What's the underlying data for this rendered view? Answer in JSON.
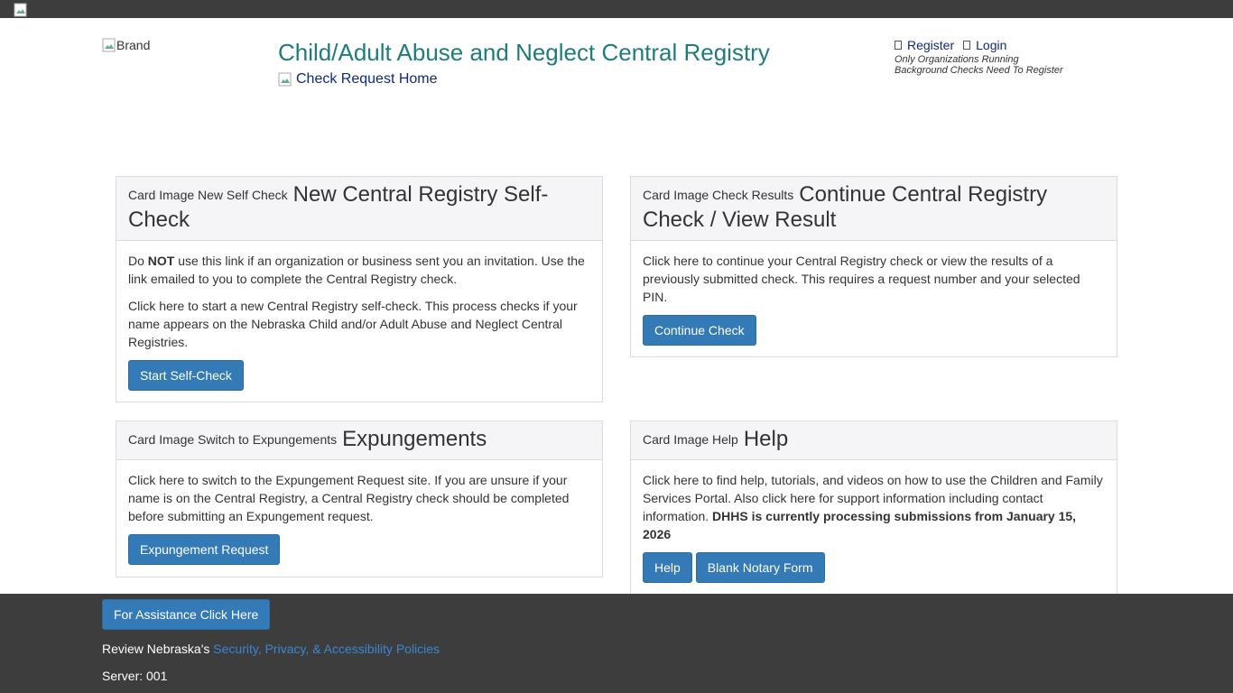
{
  "header": {
    "brand_alt": "Brand",
    "site_title": "Child/Adult Abuse and Neglect Central Registry",
    "home_link": "Check Request Home",
    "register_label": "Register",
    "login_label": "Login",
    "account_note_line1": "Only Organizations Running",
    "account_note_line2": "Background Checks Need To Register"
  },
  "cards": {
    "self_check": {
      "image_alt": "Card Image New Self Check",
      "title": "New Central Registry Self-Check",
      "p1_pre": "Do ",
      "p1_bold": "NOT",
      "p1_post": " use this link if an organization or business sent you an invitation. Use the link emailed to you to complete the Central Registry check.",
      "p2": "Click here to start a new Central Registry self-check. This process checks if your name appears on the Nebraska Child and/or Adult Abuse and Neglect Central Registries.",
      "button": "Start Self-Check"
    },
    "continue_check": {
      "image_alt": "Card Image Check Results",
      "title": "Continue Central Registry Check / View Result",
      "p1": "Click here to continue your Central Registry check or view the results of a previously submitted check. This requires a request number and your selected PIN.",
      "button": "Continue Check"
    },
    "expungements": {
      "image_alt": "Card Image Switch to Expungements",
      "title": "Expungements",
      "p1": "Click here to switch to the Expungement Request site. If you are unsure if your name is on the Central Registry, a Central Registry check should be completed before submitting an Expungement request.",
      "button": "Expungement Request"
    },
    "help": {
      "image_alt": "Card Image Help",
      "title": "Help",
      "p1": "Click here to find help, tutorials, and videos on how to use the Children and Family Services Portal. Also click here for support information including contact information. ",
      "p1_bold": "DHHS is currently processing submissions from January 15, 2026",
      "button_help": "Help",
      "button_notary": "Blank Notary Form"
    }
  },
  "footer": {
    "assist_button": "For Assistance Click Here",
    "policy_pre": "Review Nebraska's ",
    "policy_link": "Security, Privacy, & Accessibility Policies",
    "server": "Server: 001"
  },
  "colors": {
    "accent": "#337ab7",
    "title": "#1f7c7c",
    "link": "#0e2a7a",
    "footer_bg": "#3d3d3d"
  }
}
